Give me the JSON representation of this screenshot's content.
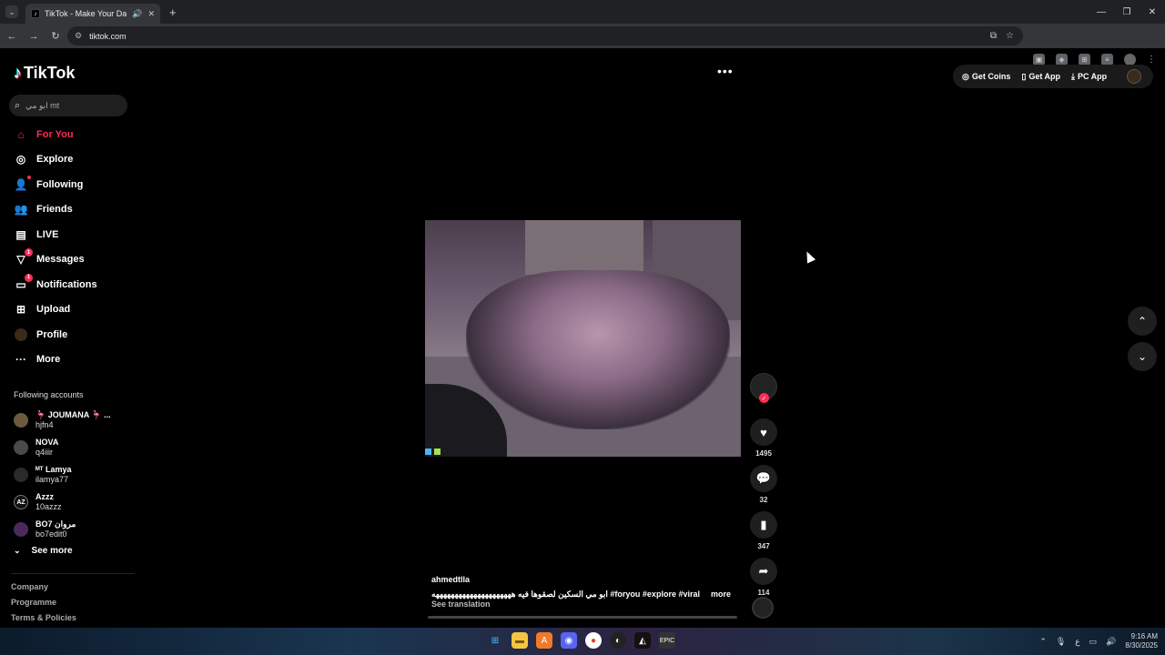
{
  "browser": {
    "tab_title": "TikTok - Make Your Day",
    "url": "tiktok.com"
  },
  "sidebar": {
    "logo_text": "TikTok",
    "search_placeholder": "ابو مي mt",
    "menu": [
      {
        "label": "For You",
        "icon": "home-icon",
        "active": true
      },
      {
        "label": "Explore",
        "icon": "compass-icon"
      },
      {
        "label": "Following",
        "icon": "following-icon"
      },
      {
        "label": "Friends",
        "icon": "friends-icon"
      },
      {
        "label": "LIVE",
        "icon": "live-icon"
      },
      {
        "label": "Messages",
        "icon": "messages-icon",
        "badge": "1"
      },
      {
        "label": "Notifications",
        "icon": "notifications-icon",
        "badge": "1"
      },
      {
        "label": "Upload",
        "icon": "upload-icon"
      },
      {
        "label": "Profile",
        "icon": "profile-avatar"
      },
      {
        "label": "More",
        "icon": "more-icon"
      }
    ],
    "following_title": "Following accounts",
    "following": [
      {
        "name": "🦩 JOUMANA 🦩 ...",
        "user": "hjfn4"
      },
      {
        "name": "NOVA",
        "user": "q4iiir"
      },
      {
        "name": "ᴹᵀ Lamya",
        "user": "ilamya77"
      },
      {
        "name": "Azzz",
        "user": "10azzz"
      },
      {
        "name": "BO7 مروان",
        "user": "bo7edit0"
      }
    ],
    "see_more": "See more",
    "footer": [
      "Company",
      "Programme",
      "Terms & Policies"
    ]
  },
  "topbar": {
    "get_coins": "Get Coins",
    "get_app": "Get App",
    "pc_app": "PC App"
  },
  "video": {
    "author": "ahmedtlla",
    "caption": "ابو مي السكين لصقوها فيه هههههههههههههههههههههه #foryou #explore #viral #mt ...",
    "more": "more",
    "see_translation": "See translation",
    "likes": "1495",
    "comments": "32",
    "saves": "347",
    "shares": "114"
  },
  "taskbar": {
    "time": "9:16 AM",
    "date": "8/30/2025",
    "lang": "ع"
  },
  "colors": {
    "accent": "#fe2c55",
    "background": "#000000"
  }
}
